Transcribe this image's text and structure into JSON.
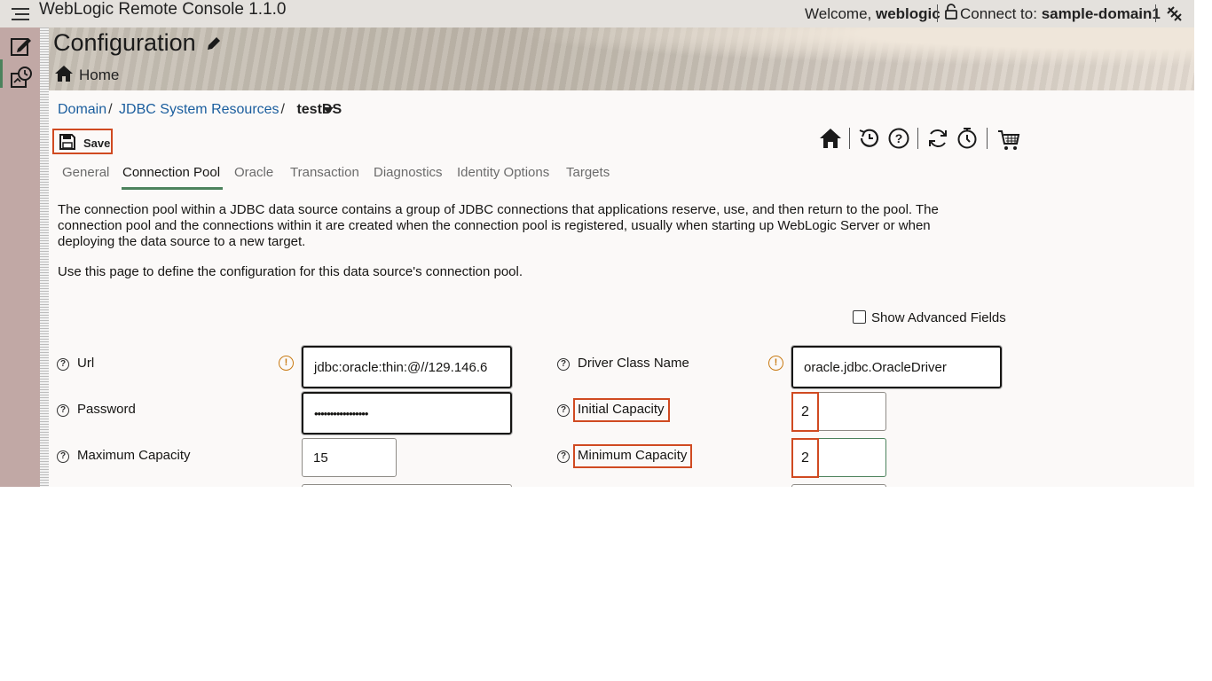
{
  "header": {
    "app_title": "WebLogic Remote Console 1.1.0",
    "welcome_prefix": "Welcome,",
    "user": "weblogic",
    "connect_prefix": "Connect to:",
    "domain": "sample-domain1"
  },
  "banner": {
    "title": "Configuration",
    "home_link": "Home"
  },
  "breadcrumb": {
    "items": [
      "Domain",
      "JDBC System Resources"
    ],
    "current": "testDS"
  },
  "toolbar": {
    "save_label": "Save"
  },
  "tabs": [
    "General",
    "Connection Pool",
    "Oracle",
    "Transaction",
    "Diagnostics",
    "Identity Options",
    "Targets"
  ],
  "active_tab": "Connection Pool",
  "description": {
    "para1": "The connection pool within a JDBC data source contains a group of JDBC connections that applications reserve, use, and then return to the pool. The connection pool and the connections within it are created when the connection pool is registered, usually when starting up WebLogic Server or when deploying the data source to a new target.",
    "para2": "Use this page to define the configuration for this data source's connection pool."
  },
  "show_advanced": {
    "label": "Show Advanced Fields",
    "checked": false
  },
  "form": {
    "url": {
      "label": "Url",
      "value": "jdbc:oracle:thin:@//129.146.6"
    },
    "driver": {
      "label": "Driver Class Name",
      "value": "oracle.jdbc.OracleDriver"
    },
    "password": {
      "label": "Password",
      "value": "•••••••••••••••••"
    },
    "initial_capacity": {
      "label": "Initial Capacity",
      "value": "2"
    },
    "max_capacity": {
      "label": "Maximum Capacity",
      "value": "15"
    },
    "min_capacity": {
      "label": "Minimum Capacity",
      "value": "2"
    }
  },
  "colors": {
    "accent_green": "#4c825c",
    "highlight_orange": "#d04a21",
    "link_blue": "#1b5e9e",
    "rail": "#c1a8a5",
    "warning": "#c97b14"
  }
}
